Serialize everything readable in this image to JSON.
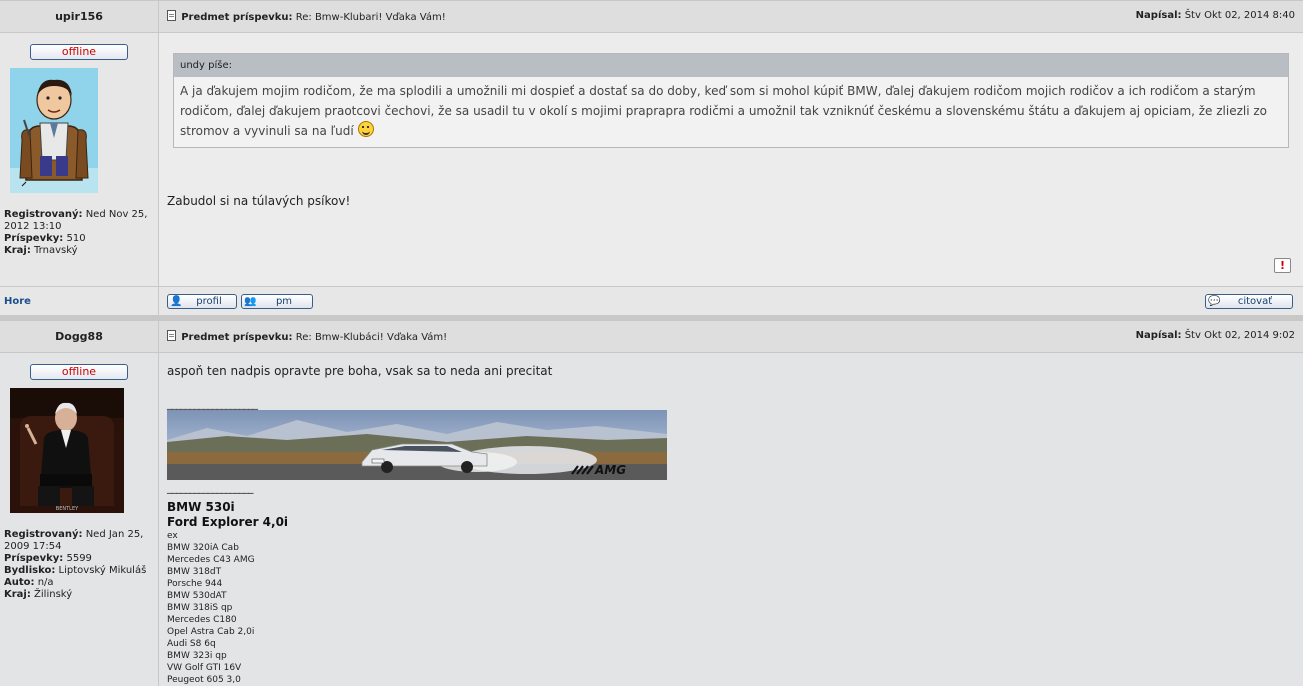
{
  "posts": [
    {
      "author": "upir156",
      "status": "offline",
      "subject_label": "Predmet príspevku:",
      "subject": "Re: Bmw-Klubari! Vďaka Vám!",
      "posted_label": "Napísal:",
      "posted": "Štv Okt 02, 2014 8:40",
      "profile": {
        "registered_label": "Registrovaný:",
        "registered": "Ned Nov 25, 2012 13:10",
        "posts_label": "Príspevky:",
        "posts": "510",
        "region_label": "Kraj:",
        "region": "Trnavský"
      },
      "quote": {
        "header": "undy píše:",
        "text": "A ja ďakujem mojim rodičom, že ma splodili a umožnili mi dospieť a dostať sa do doby, keď som si mohol kúpiť BMW, ďalej ďakujem rodičom mojich rodičov a ich rodičom a starým rodičom, ďalej ďakujem praotcovi čechovi, že sa usadil tu v okolí s mojimi praprapra rodičmi a umožnil tak vzniknúť českému a slovenskému štátu a ďakujem aj opiciam, že zliezli zo stromov a vyvinuli sa na ľudí"
      },
      "message": "Zabudol si na túlavých psíkov!",
      "footer": {
        "top_link": "Hore",
        "profile_btn": "profil",
        "pm_btn": "pm",
        "quote_btn": "citovať"
      }
    },
    {
      "author": "Dogg88",
      "status": "offline",
      "subject_label": "Predmet príspevku:",
      "subject": "Re: Bmw-Klubáci! Vďaka Vám!",
      "posted_label": "Napísal:",
      "posted": "Štv Okt 02, 2014 9:02",
      "profile": {
        "registered_label": "Registrovaný:",
        "registered": "Ned Jan 25, 2009 17:54",
        "posts_label": "Príspevky:",
        "posts": "5599",
        "residence_label": "Bydlisko:",
        "residence": "Liptovský Mikuláš",
        "auto_label": "Auto:",
        "auto": "n/a",
        "region_label": "Kraj:",
        "region": "Žilinský"
      },
      "message": "aspoň ten nadpis opravte pre boha, vsak sa to neda ani precitat",
      "signature": {
        "line1": "____________________",
        "line2": "___________________",
        "banner_text": "AMG",
        "cars_big": [
          "BMW 530i",
          "Ford Explorer 4,0i"
        ],
        "ex_label": "ex",
        "cars_small": [
          "BMW 320iA Cab",
          "Mercedes C43 AMG",
          "BMW 318dT",
          "Porsche 944",
          "BMW 530dAT",
          "BMW 318iS qp",
          "Mercedes C180",
          "Opel Astra Cab 2,0i",
          "Audi S8 6q",
          "BMW 323i qp",
          "VW Golf GTI 16V",
          "Peugeot 605 3,0"
        ]
      }
    }
  ]
}
